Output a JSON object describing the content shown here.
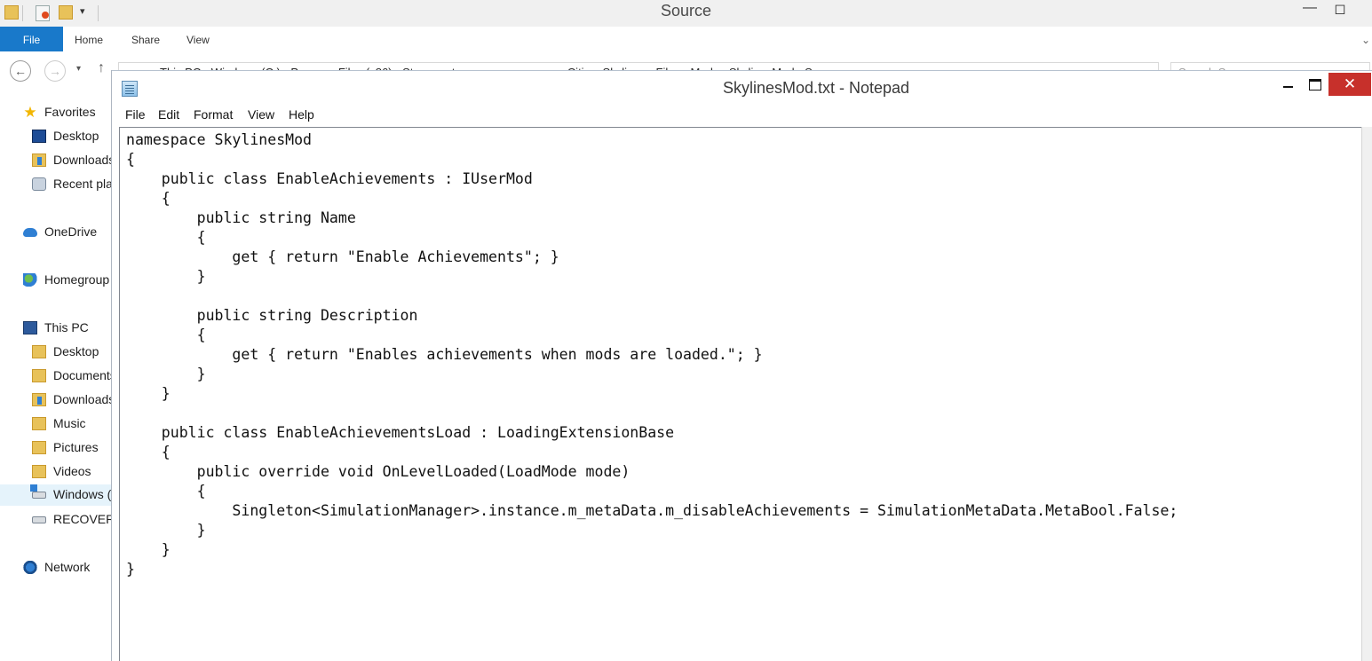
{
  "explorer": {
    "title": "Source",
    "ribbon_tabs": [
      "File",
      "Home",
      "Share",
      "View"
    ],
    "address_path": [
      "This PC",
      "Windows (C:)",
      "Program Files (x86)",
      "Steam",
      "steamapps",
      "common",
      "Cities_Skylines",
      "Files",
      "Mods",
      "SkylinesMod",
      "Source"
    ],
    "address_separator": "›",
    "search_placeholder": "Search Source",
    "nav_pane": {
      "favorites": "Favorites",
      "favorites_items": [
        "Desktop",
        "Downloads",
        "Recent places"
      ],
      "onedrive": "OneDrive",
      "homegroup": "Homegroup",
      "this_pc": "This PC",
      "this_pc_items": [
        "Desktop",
        "Documents",
        "Downloads",
        "Music",
        "Pictures",
        "Videos",
        "Windows (C:)",
        "RECOVERY"
      ],
      "network": "Network",
      "selected": "Windows (C:)"
    }
  },
  "notepad": {
    "title": "SkylinesMod.txt - Notepad",
    "menu": [
      "File",
      "Edit",
      "Format",
      "View",
      "Help"
    ],
    "content": [
      "namespace SkylinesMod",
      "{",
      "    public class EnableAchievements : IUserMod",
      "    {",
      "        public string Name",
      "        {",
      "            get { return \"Enable Achievements\"; }",
      "        }",
      "",
      "        public string Description",
      "        {",
      "            get { return \"Enables achievements when mods are loaded.\"; }",
      "        }",
      "    }",
      "",
      "    public class EnableAchievementsLoad : LoadingExtensionBase",
      "    {",
      "        public override void OnLevelLoaded(LoadMode mode)",
      "        {",
      "            Singleton<SimulationManager>.instance.m_metaData.m_disableAchievements = SimulationMetaData.MetaBool.False;",
      "        }",
      "    }",
      "}"
    ]
  },
  "colors": {
    "file_tab": "#1979ca",
    "close_button": "#c7302b",
    "selection": "#e5f3fb"
  }
}
